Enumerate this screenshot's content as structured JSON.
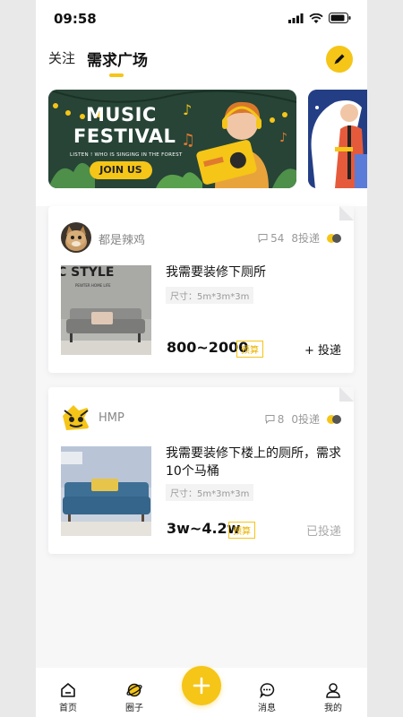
{
  "status_bar": {
    "time": "09:58"
  },
  "header": {
    "tab_follow": "关注",
    "tab_square": "需求广场"
  },
  "banner": {
    "title_line1": "MUSIC",
    "title_line2": "FESTIVAL",
    "subtitle": "LISTEN ! WHO IS SINGING IN THE FOREST",
    "cta": "JOIN US"
  },
  "posts": [
    {
      "user": "都是辣鸡",
      "comments": "54",
      "delivered": "8投递",
      "thumb_text": "C STYLE",
      "thumb_sub": "PEWTER HOME LIFE",
      "title": "我需要装修下厕所",
      "size": "尺寸：5m*3m*3m",
      "price": "800~2000",
      "budget_tag": "预算",
      "action": "+ 投递"
    },
    {
      "user": "HMP",
      "comments": "8",
      "delivered": "0投递",
      "title": "我需要装修下楼上的厕所，需求10个马桶",
      "size": "尺寸：5m*3m*3m",
      "price": "3w~4.2w",
      "budget_tag": "预算",
      "action": "已投递"
    }
  ],
  "nav": {
    "home": "首页",
    "circle": "圈子",
    "messages": "消息",
    "mine": "我的"
  },
  "colors": {
    "accent": "#f5c518",
    "banner_bg": "#274437"
  }
}
